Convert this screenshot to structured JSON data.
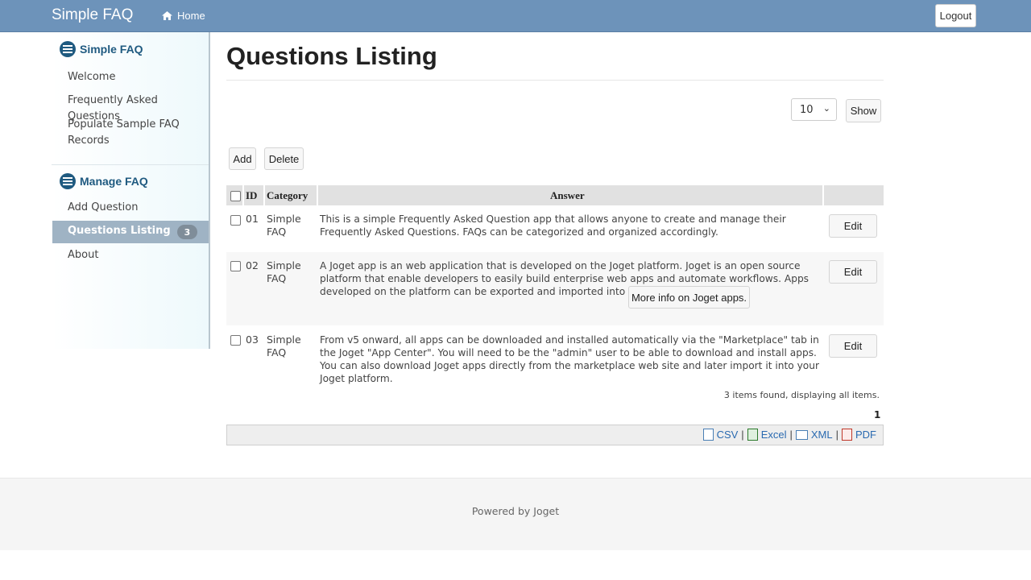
{
  "header": {
    "brand": "Simple FAQ",
    "home_label": "Home",
    "logout_label": "Logout"
  },
  "sidebar": {
    "section1_title": "Simple FAQ",
    "section1_items": [
      "Welcome",
      "Frequently Asked Questions",
      "Populate Sample FAQ Records"
    ],
    "section2_title": "Manage FAQ",
    "section2_items": [
      "Add Question",
      "Questions Listing",
      "About"
    ],
    "active_badge": "3"
  },
  "main": {
    "title": "Questions Listing",
    "page_size": "10",
    "show_label": "Show",
    "add_label": "Add",
    "delete_label": "Delete",
    "columns": [
      "ID",
      "Category",
      "Answer"
    ],
    "rows": [
      {
        "id": "01",
        "category": "Simple FAQ",
        "answer": "This is a simple Frequently Asked Question app that allows anyone to create and manage their Frequently Asked Questions. FAQs can be categorized and organized accordingly."
      },
      {
        "id": "02",
        "category": "Simple FAQ",
        "answer": "A Joget app is an web application that is developed on the Joget platform. Joget is an open source platform that enable developers to easily build enterprise web apps and automate workflows. Apps developed on the platform can be exported and imported into other Joget platforms.",
        "link_button": "More info on Joget apps."
      },
      {
        "id": "03",
        "category": "Simple FAQ",
        "answer": "From v5 onward, all apps can be downloaded and installed automatically via the \"Marketplace\" tab in the Joget \"App Center\". You will need to be the \"admin\" user to be able to download and install apps. You can also download Joget apps directly from the marketplace web site and later import it into your Joget platform."
      }
    ],
    "edit_label": "Edit",
    "summary": "3 items found, displaying all items.",
    "page_number": "1",
    "exports": [
      "CSV",
      "Excel",
      "XML",
      "PDF"
    ]
  },
  "footer": {
    "text": "Powered by Joget"
  }
}
